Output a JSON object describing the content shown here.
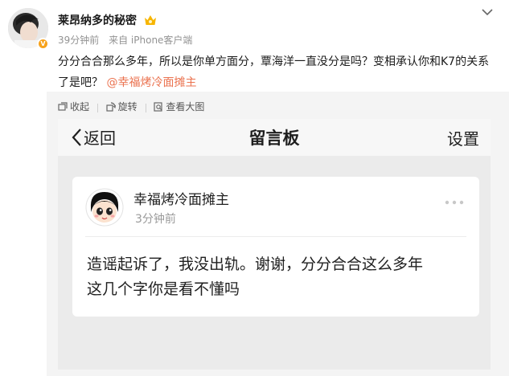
{
  "post": {
    "username": "莱昂纳多的秘密",
    "time": "39分钟前",
    "source": "来自 iPhone客户端",
    "text": "分分合合那么多年，所以是你单方面分，覃海洋一直没分是吗？变相承认你和K7的关系了是吧？",
    "mention": "@幸福烤冷面摊主",
    "icons": {
      "avatar": "user-avatar",
      "verified": "verified-badge",
      "badge": "crown-badge",
      "more": "chevron-down-icon"
    }
  },
  "embed_actions": [
    {
      "label": "收起",
      "icon": "collapse-icon"
    },
    {
      "label": "旋转",
      "icon": "rotate-icon"
    },
    {
      "label": "查看大图",
      "icon": "zoom-icon"
    }
  ],
  "screenshot": {
    "back_label": "返回",
    "title": "留言板",
    "settings_label": "设置",
    "comment": {
      "author": "幸福烤冷面摊主",
      "time": "3分钟前",
      "text_line1": "造谣起诉了，我没出轨。谢谢，分分合合这么多年",
      "text_line2": "这几个字你是看不懂吗"
    }
  },
  "colors": {
    "mention": "#eb7350",
    "meta_gray": "#939393",
    "verified": "#f7a21b"
  }
}
